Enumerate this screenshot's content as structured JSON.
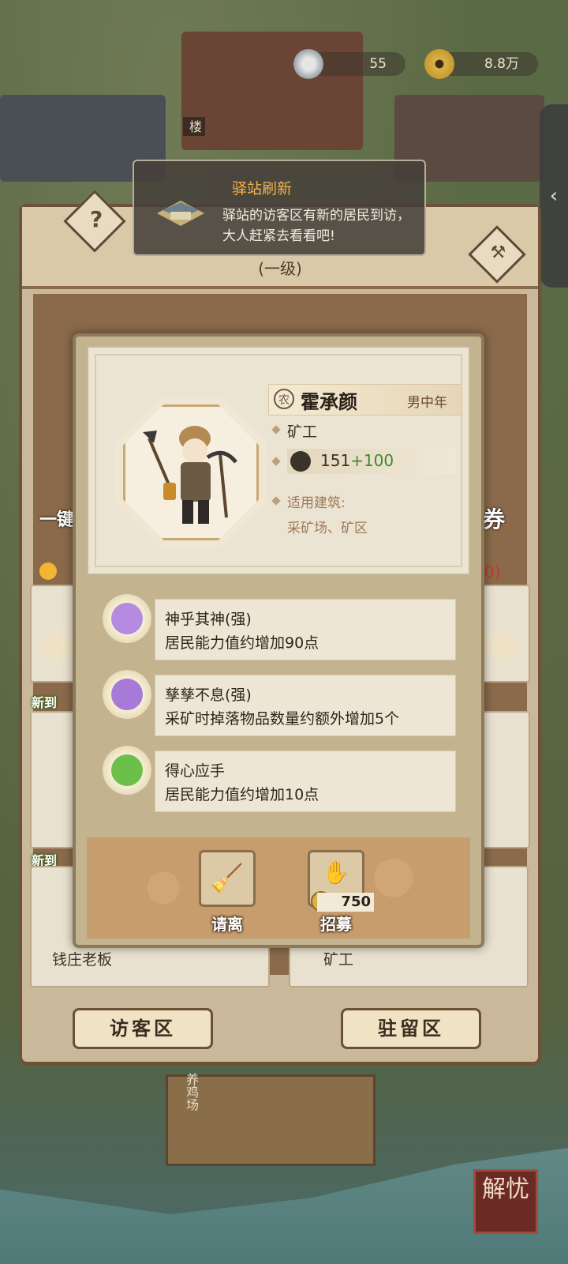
{
  "currency": {
    "silver": "55",
    "copper": "8.8万"
  },
  "side_handle_glyph": "‹",
  "toast": {
    "title": "驿站刷新",
    "body": "驿站的访客区有新的居民到访，大人赶紧去看看吧!"
  },
  "station": {
    "level": "(一级)",
    "help_glyph": "?",
    "left_label": "一键",
    "right_label": "券",
    "warning_tail": "0)"
  },
  "background_list": {
    "new_tag": "新到",
    "left_card_label": "钱庄老板",
    "right_card_label": "矿工"
  },
  "bottom_tabs": {
    "visitor": "访客区",
    "resident": "驻留区"
  },
  "map_labels": {
    "tower": "楼",
    "chicken_farm": "养鸡场"
  },
  "corner_badge": "解忧",
  "resident": {
    "class_seal": "农",
    "name": "霍承颜",
    "gender_age": "男中年",
    "job": "矿工",
    "power_base": "151",
    "power_bonus": "+100",
    "applicable_label": "适用建筑:",
    "applicable_value": "采矿场、矿区"
  },
  "traits": [
    {
      "name": "神乎其神(强)",
      "desc": "居民能力值约增加90点",
      "icon": "buddha-icon",
      "color": "#b48be0"
    },
    {
      "name": "孳孳不息(强)",
      "desc": "采矿时掉落物品数量约额外增加5个",
      "icon": "pickaxe-icon",
      "color": "#a77ad8"
    },
    {
      "name": "得心应手",
      "desc": "居民能力值约增加10点",
      "icon": "muscle-icon",
      "color": "#6cc04a"
    }
  ],
  "actions": {
    "dismiss": "请离",
    "recruit": "招募",
    "recruit_cost": "750"
  }
}
